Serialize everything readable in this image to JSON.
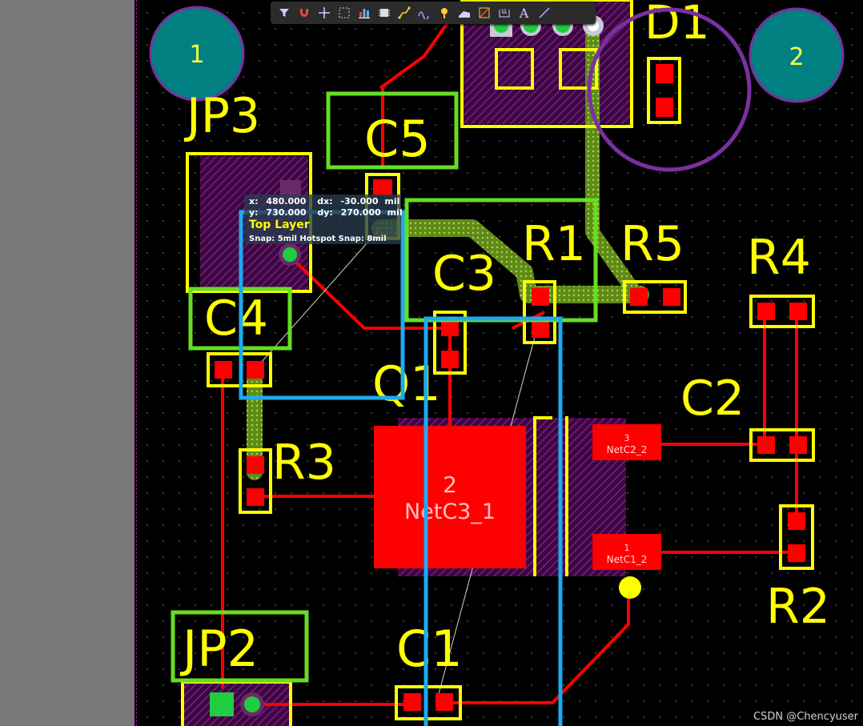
{
  "toolbar": {
    "tools": [
      {
        "name": "filter-tool",
        "icon": "filter-icon"
      },
      {
        "name": "route-tool",
        "icon": "magnet-icon"
      },
      {
        "name": "crosshair-tool",
        "icon": "crosshair-icon"
      },
      {
        "name": "select-rect-tool",
        "icon": "select-rect-icon"
      },
      {
        "name": "align-tool",
        "icon": "bar-chart-icon"
      },
      {
        "name": "component-tool",
        "icon": "chip-icon"
      },
      {
        "name": "interactive-route-tool",
        "icon": "route-icon"
      },
      {
        "name": "diff-pair-tool",
        "icon": "wave-icon"
      },
      {
        "name": "via-tool",
        "icon": "via-icon"
      },
      {
        "name": "fill-tool",
        "icon": "fill-icon"
      },
      {
        "name": "polygon-tool",
        "icon": "polygon-icon"
      },
      {
        "name": "dimension-tool",
        "icon": "dimension-icon"
      },
      {
        "name": "string-tool",
        "icon": "text-icon",
        "label": "A"
      },
      {
        "name": "line-tool",
        "icon": "line-icon"
      }
    ]
  },
  "hud": {
    "x_label": "x:",
    "x_value": "480.000",
    "dx_label": "dx:",
    "dx_value": "-30.000",
    "dx_unit": "mil",
    "y_label": "y:",
    "y_value": "730.000",
    "dy_label": "dy:",
    "dy_value": "270.000",
    "dy_unit": "mil",
    "layer": "Top Layer",
    "snap": "Snap: 5mil Hotspot Snap: 8mil"
  },
  "board": {
    "mounting_holes": [
      {
        "label": "1"
      },
      {
        "label": "2"
      }
    ],
    "designators": {
      "d1": "D1",
      "jp3": "JP3",
      "c5": "C5",
      "r1": "R1",
      "r5": "R5",
      "r4": "R4",
      "c3": "C3",
      "c4": "C4",
      "q1": "Q1",
      "c2": "C2",
      "r3": "R3",
      "r2": "R2",
      "jp2": "JP2",
      "c1": "C1"
    },
    "pads": {
      "q1_tab_number": "2",
      "q1_tab_net": "NetC3_1",
      "q1_pin3_number": "3",
      "q1_pin3_net": "NetC2_2",
      "q1_pin1_number": "1",
      "q1_pin1_net": "NetC1_2"
    }
  },
  "colors": {
    "silkscreen": "#ffff00",
    "top_copper": "#ff0000",
    "mech_hatch": "#a020a0",
    "highlight_green": "#66dd22",
    "highlight_blue": "#1eaaee",
    "highlight_purple": "#7a30a0",
    "hole_fill": "#008080",
    "selected_net": "#6a9a20"
  },
  "watermark": "CSDN @Chencyuser"
}
